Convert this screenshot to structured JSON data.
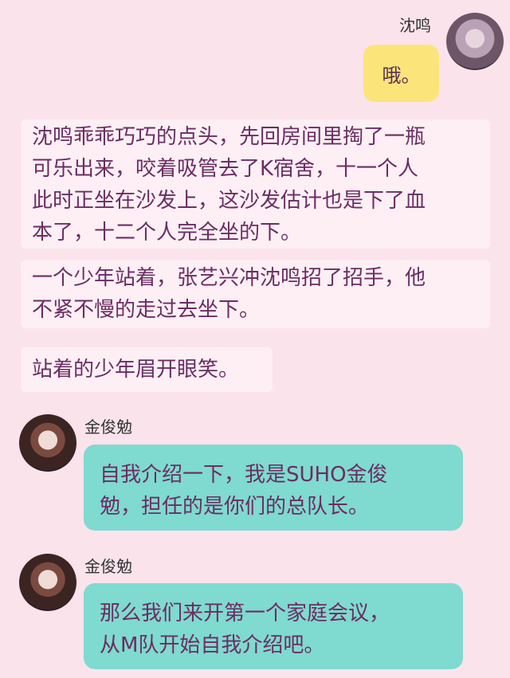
{
  "messages": [
    {
      "speaker": "沈鸣",
      "text": "哦。"
    },
    {
      "narration_lines": [
        "沈鸣乖乖巧巧的点头，先回房间里掏了一瓶",
        "可乐出来，咬着吸管去了K宿舍，十一个人",
        "此时正坐在沙发上，这沙发估计也是下了血",
        "本了，十二个人完全坐的下。"
      ]
    },
    {
      "narration_lines": [
        "一个少年站着，张艺兴冲沈鸣招了招手，他",
        "不紧不慢的走过去坐下。"
      ]
    },
    {
      "narration_lines": [
        "站着的少年眉开眼笑。"
      ]
    },
    {
      "speaker": "金俊勉",
      "lines": [
        "自我介绍一下，我是SUHO金俊",
        "勉，担任的是你们的总队长。"
      ]
    },
    {
      "speaker": "金俊勉",
      "lines": [
        "那么我们来开第一个家庭会议，",
        "从M队开始自我介绍吧。"
      ]
    }
  ],
  "colors": {
    "background": "#fbe3ec",
    "narration_bg": "#fdeff4",
    "text": "#6b2d63",
    "yellow_bubble": "#fbe57a",
    "teal_bubble": "#7fdad0"
  },
  "icons": [
    "avatar-shen-ming",
    "avatar-jin-junmian"
  ]
}
